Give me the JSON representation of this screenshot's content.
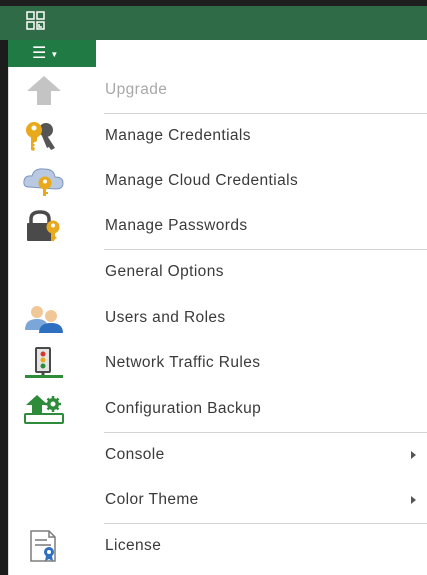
{
  "menu_button": {
    "icon": "hamburger-menu-icon"
  },
  "menu": {
    "items": [
      {
        "label": "Upgrade",
        "icon": "upgrade-arrow-icon",
        "enabled": false
      },
      {
        "label": "Manage Credentials",
        "icon": "keys-icon"
      },
      {
        "label": "Manage Cloud Credentials",
        "icon": "cloud-key-icon"
      },
      {
        "label": "Manage Passwords",
        "icon": "padlock-key-icon"
      },
      {
        "label": "General Options",
        "icon": "none"
      },
      {
        "label": "Users and Roles",
        "icon": "users-icon"
      },
      {
        "label": "Network Traffic Rules",
        "icon": "traffic-light-icon"
      },
      {
        "label": "Configuration Backup",
        "icon": "config-backup-icon"
      },
      {
        "label": "Console",
        "icon": "none",
        "submenu": true
      },
      {
        "label": "Color Theme",
        "icon": "none",
        "submenu": true
      },
      {
        "label": "License",
        "icon": "license-icon"
      }
    ]
  },
  "colors": {
    "title_bar": "#2e6b46",
    "menu_button": "#1f7a43",
    "text": "#3a3a3a",
    "disabled_text": "#a8a8a8"
  }
}
